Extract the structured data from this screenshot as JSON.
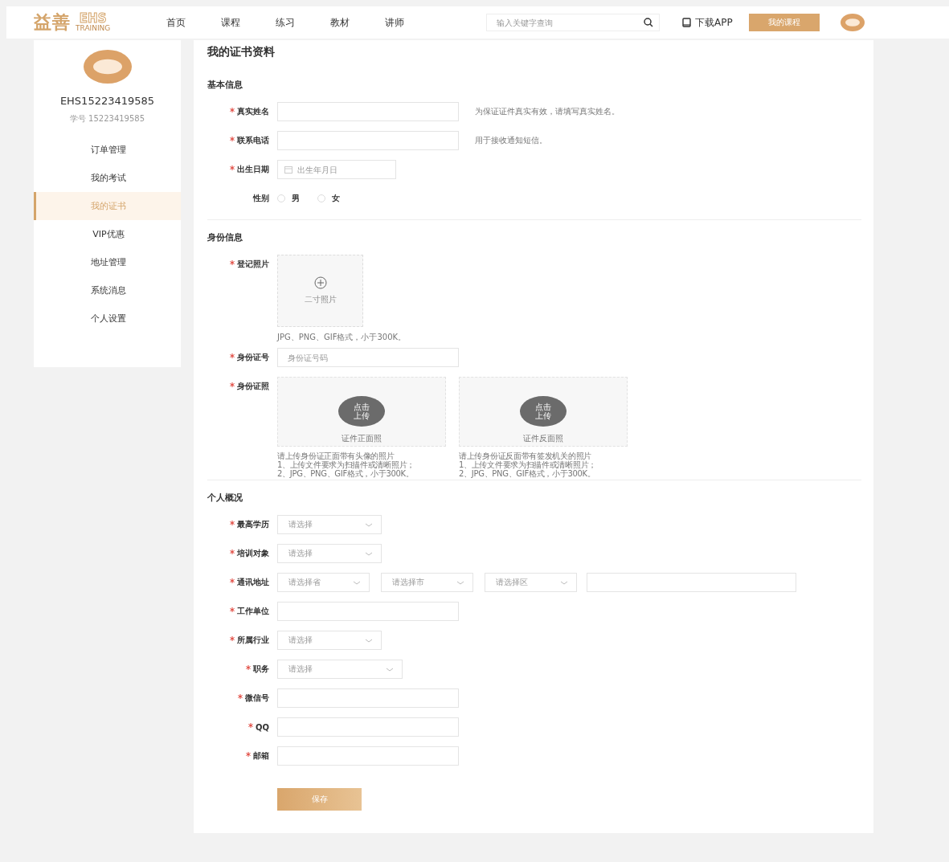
{
  "header": {
    "logo": {
      "mark": "益善",
      "brand": "EHS",
      "tagline": "TRAINING"
    },
    "nav": [
      {
        "label": "首页"
      },
      {
        "label": "课程"
      },
      {
        "label": "练习"
      },
      {
        "label": "教材"
      },
      {
        "label": "讲师"
      }
    ],
    "search": {
      "placeholder": "输入关键字查询"
    },
    "download": "下载APP",
    "my_courses": "我的课程"
  },
  "sidebar": {
    "username": "EHS15223419585",
    "student_id": "学号 15223419585",
    "items": [
      {
        "label": "订单管理",
        "selected": false
      },
      {
        "label": "我的考试",
        "selected": false
      },
      {
        "label": "我的证书",
        "selected": true
      },
      {
        "label": "VIP优惠",
        "selected": false
      },
      {
        "label": "地址管理",
        "selected": false
      },
      {
        "label": "系统消息",
        "selected": false
      },
      {
        "label": "个人设置",
        "selected": false
      }
    ]
  },
  "page_title": "我的证书资料",
  "sections": [
    {
      "title": "基本信息",
      "fields": [
        {
          "kind": "text",
          "label": "真实姓名",
          "required": true,
          "hint": "为保证证件真实有效，请填写真实姓名。"
        },
        {
          "kind": "text",
          "label": "联系电话",
          "required": true,
          "hint": "用于接收通知短信。"
        },
        {
          "kind": "date",
          "label": "出生日期",
          "required": true,
          "placeholder": "出生年月日"
        },
        {
          "kind": "radio",
          "label": "性别",
          "required": false,
          "options": [
            {
              "label": "男",
              "selected": false
            },
            {
              "label": "女",
              "selected": false
            }
          ]
        }
      ]
    },
    {
      "title": "身份信息",
      "fields": [
        {
          "kind": "photo",
          "label": "登记照片",
          "required": true,
          "caption": "二寸照片",
          "hint": "JPG、PNG、GIF格式，小于300K。"
        },
        {
          "kind": "text",
          "label": "身份证号",
          "required": true,
          "placeholder": "身份证号码"
        },
        {
          "kind": "idcard",
          "label": "身份证照",
          "required": true,
          "cards": [
            {
              "button": [
                "点击",
                "上传"
              ],
              "caption": "证件正面照",
              "notes": [
                "请上传身份证正面带有头像的照片",
                "1、上传文件要求为扫描件或清晰照片；",
                "2、JPG、PNG、GIF格式，小于300K。"
              ]
            },
            {
              "button": [
                "点击",
                "上传"
              ],
              "caption": "证件反面照",
              "notes": [
                "请上传身份证反面带有签发机关的照片",
                "1、上传文件要求为扫描件或清晰照片；",
                "2、JPG、PNG、GIF格式，小于300K。"
              ]
            }
          ]
        }
      ]
    },
    {
      "title": "个人概况",
      "fields": [
        {
          "kind": "select",
          "label": "最高学历",
          "required": true,
          "placeholder": "请选择"
        },
        {
          "kind": "select",
          "label": "培训对象",
          "required": true,
          "placeholder": "请选择"
        },
        {
          "kind": "address",
          "label": "通讯地址",
          "required": true,
          "selects": [
            "请选择省",
            "请选择市",
            "请选择区"
          ]
        },
        {
          "kind": "text",
          "label": "工作单位",
          "required": true
        },
        {
          "kind": "select",
          "label": "所属行业",
          "required": true,
          "placeholder": "请选择"
        },
        {
          "kind": "select-wide",
          "label": "职务",
          "required": true,
          "placeholder": "请选择"
        },
        {
          "kind": "text",
          "label": "微信号",
          "required": true
        },
        {
          "kind": "text",
          "label": "QQ",
          "required": true
        },
        {
          "kind": "text",
          "label": "邮箱",
          "required": true
        }
      ]
    }
  ],
  "save_button": "保存"
}
